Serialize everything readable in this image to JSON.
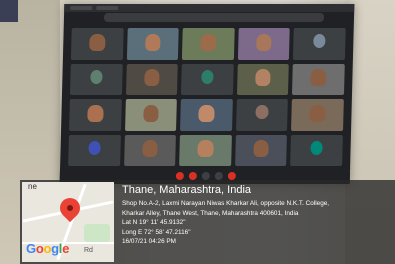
{
  "location": {
    "city_line": "Thane, Maharashtra, India",
    "address_line1": "Shop No.A-2, Laxmi Narayan Niwas Kharkar Ali, opposite N.K.T. College,",
    "address_line2": "Kharkar Alley, Thane West, Thane, Maharashtra 400601, India",
    "lat": "Lat N 19° 11' 45.9132\"",
    "long": "Long E 72° 58' 47.2116\"",
    "datetime": "16/07/21 04:26 PM"
  },
  "map": {
    "partial_label": "ne",
    "logo_text": [
      "G",
      "o",
      "o",
      "g",
      "l",
      "e"
    ],
    "road_label": "Rd"
  },
  "colors": {
    "pin": "#ea4335",
    "overlay": "rgba(40,40,40,0.78)"
  }
}
